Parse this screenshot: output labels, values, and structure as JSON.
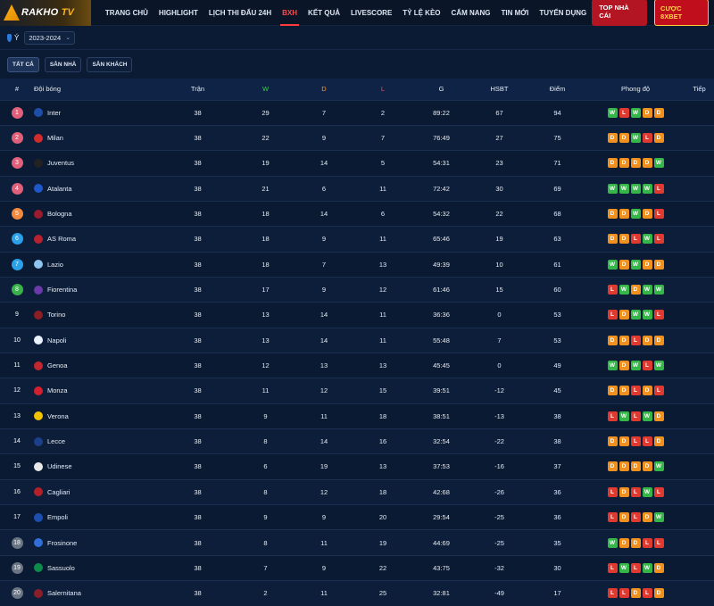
{
  "header": {
    "logo_main": "RAKHO",
    "logo_tv": "TV",
    "nav": [
      "TRANG CHỦ",
      "HIGHLIGHT",
      "LỊCH THI ĐẤU 24H",
      "BXH",
      "KẾT QUẢ",
      "LIVESCORE",
      "TỶ LỆ KÈO",
      "CẨM NANG",
      "TIN MỚI",
      "TUYỂN DỤNG"
    ],
    "active_nav": "BXH",
    "btn_top": "TOP NHÀ CÁI",
    "btn_8x": "CƯỢC 8XBET"
  },
  "filters": {
    "league": "Ý",
    "season": "2023-2024",
    "tabs": [
      "TẤT CẢ",
      "SÂN NHÀ",
      "SÂN KHÁCH"
    ],
    "active_tab": "TẤT CẢ"
  },
  "table": {
    "headers": {
      "rank": "#",
      "team": "Đội bóng",
      "played": "Trận",
      "w": "W",
      "d": "D",
      "l": "L",
      "g": "G",
      "gd": "HSBT",
      "pts": "Điểm",
      "form": "Phong độ",
      "next": "Tiếp"
    },
    "rows": [
      {
        "rank": "1",
        "zone": "ucl",
        "team": "Inter",
        "crest": "#1e4fa8",
        "played": "38",
        "w": "29",
        "d": "7",
        "l": "2",
        "g": "89:22",
        "gd": "67",
        "pts": "94",
        "form": [
          "W",
          "L",
          "W",
          "D",
          "D"
        ]
      },
      {
        "rank": "2",
        "zone": "ucl",
        "team": "Milan",
        "crest": "#d12b2b",
        "played": "38",
        "w": "22",
        "d": "9",
        "l": "7",
        "g": "76:49",
        "gd": "27",
        "pts": "75",
        "form": [
          "D",
          "D",
          "W",
          "L",
          "D"
        ]
      },
      {
        "rank": "3",
        "zone": "ucl",
        "team": "Juventus",
        "crest": "#222222",
        "played": "38",
        "w": "19",
        "d": "14",
        "l": "5",
        "g": "54:31",
        "gd": "23",
        "pts": "71",
        "form": [
          "D",
          "D",
          "D",
          "D",
          "W"
        ]
      },
      {
        "rank": "4",
        "zone": "ucl",
        "team": "Atalanta",
        "crest": "#1f58c9",
        "played": "38",
        "w": "21",
        "d": "6",
        "l": "11",
        "g": "72:42",
        "gd": "30",
        "pts": "69",
        "form": [
          "W",
          "W",
          "W",
          "W",
          "L"
        ]
      },
      {
        "rank": "5",
        "zone": "uel",
        "team": "Bologna",
        "crest": "#9b1c2c",
        "played": "38",
        "w": "18",
        "d": "14",
        "l": "6",
        "g": "54:32",
        "gd": "22",
        "pts": "68",
        "form": [
          "D",
          "D",
          "W",
          "D",
          "L"
        ]
      },
      {
        "rank": "6",
        "zone": "uecl",
        "team": "AS Roma",
        "crest": "#b8222f",
        "played": "38",
        "w": "18",
        "d": "9",
        "l": "11",
        "g": "65:46",
        "gd": "19",
        "pts": "63",
        "form": [
          "D",
          "D",
          "L",
          "W",
          "L"
        ]
      },
      {
        "rank": "7",
        "zone": "uecl",
        "team": "Lazio",
        "crest": "#8fc4ec",
        "played": "38",
        "w": "18",
        "d": "7",
        "l": "13",
        "g": "49:39",
        "gd": "10",
        "pts": "61",
        "form": [
          "W",
          "D",
          "W",
          "D",
          "D"
        ]
      },
      {
        "rank": "8",
        "zone": "conf",
        "team": "Fiorentina",
        "crest": "#6a3aa8",
        "played": "38",
        "w": "17",
        "d": "9",
        "l": "12",
        "g": "61:46",
        "gd": "15",
        "pts": "60",
        "form": [
          "L",
          "W",
          "D",
          "W",
          "W"
        ]
      },
      {
        "rank": "9",
        "zone": "",
        "team": "Torino",
        "crest": "#8b1f24",
        "played": "38",
        "w": "13",
        "d": "14",
        "l": "11",
        "g": "36:36",
        "gd": "0",
        "pts": "53",
        "form": [
          "L",
          "D",
          "W",
          "W",
          "L"
        ]
      },
      {
        "rank": "10",
        "zone": "",
        "team": "Napoli",
        "crest": "#eaf2ff",
        "played": "38",
        "w": "13",
        "d": "14",
        "l": "11",
        "g": "55:48",
        "gd": "7",
        "pts": "53",
        "form": [
          "D",
          "D",
          "L",
          "D",
          "D"
        ]
      },
      {
        "rank": "11",
        "zone": "",
        "team": "Genoa",
        "crest": "#c2272f",
        "played": "38",
        "w": "12",
        "d": "13",
        "l": "13",
        "g": "45:45",
        "gd": "0",
        "pts": "49",
        "form": [
          "W",
          "D",
          "W",
          "L",
          "W"
        ]
      },
      {
        "rank": "12",
        "zone": "",
        "team": "Monza",
        "crest": "#d32030",
        "played": "38",
        "w": "11",
        "d": "12",
        "l": "15",
        "g": "39:51",
        "gd": "-12",
        "pts": "45",
        "form": [
          "D",
          "D",
          "L",
          "D",
          "L"
        ]
      },
      {
        "rank": "13",
        "zone": "",
        "team": "Verona",
        "crest": "#f2c300",
        "played": "38",
        "w": "9",
        "d": "11",
        "l": "18",
        "g": "38:51",
        "gd": "-13",
        "pts": "38",
        "form": [
          "L",
          "W",
          "L",
          "W",
          "D"
        ]
      },
      {
        "rank": "14",
        "zone": "",
        "team": "Lecce",
        "crest": "#1c3f8a",
        "played": "38",
        "w": "8",
        "d": "14",
        "l": "16",
        "g": "32:54",
        "gd": "-22",
        "pts": "38",
        "form": [
          "D",
          "D",
          "L",
          "L",
          "D"
        ]
      },
      {
        "rank": "15",
        "zone": "",
        "team": "Udinese",
        "crest": "#e8e8e8",
        "played": "38",
        "w": "6",
        "d": "19",
        "l": "13",
        "g": "37:53",
        "gd": "-16",
        "pts": "37",
        "form": [
          "D",
          "D",
          "D",
          "D",
          "W"
        ]
      },
      {
        "rank": "16",
        "zone": "",
        "team": "Cagliari",
        "crest": "#b3202a",
        "played": "38",
        "w": "8",
        "d": "12",
        "l": "18",
        "g": "42:68",
        "gd": "-26",
        "pts": "36",
        "form": [
          "L",
          "D",
          "L",
          "W",
          "L"
        ]
      },
      {
        "rank": "17",
        "zone": "",
        "team": "Empoli",
        "crest": "#1d4fb0",
        "played": "38",
        "w": "9",
        "d": "9",
        "l": "20",
        "g": "29:54",
        "gd": "-25",
        "pts": "36",
        "form": [
          "L",
          "D",
          "L",
          "D",
          "W"
        ]
      },
      {
        "rank": "18",
        "zone": "rel",
        "team": "Frosinone",
        "crest": "#2f6fd6",
        "played": "38",
        "w": "8",
        "d": "11",
        "l": "19",
        "g": "44:69",
        "gd": "-25",
        "pts": "35",
        "form": [
          "W",
          "D",
          "D",
          "L",
          "L"
        ]
      },
      {
        "rank": "19",
        "zone": "rel",
        "team": "Sassuolo",
        "crest": "#0f8a4a",
        "played": "38",
        "w": "7",
        "d": "9",
        "l": "22",
        "g": "43:75",
        "gd": "-32",
        "pts": "30",
        "form": [
          "L",
          "W",
          "L",
          "W",
          "D"
        ]
      },
      {
        "rank": "20",
        "zone": "rel",
        "team": "Salernitana",
        "crest": "#8a1f2a",
        "played": "38",
        "w": "2",
        "d": "11",
        "l": "25",
        "g": "32:81",
        "gd": "-49",
        "pts": "17",
        "form": [
          "L",
          "L",
          "D",
          "L",
          "D"
        ]
      }
    ]
  }
}
